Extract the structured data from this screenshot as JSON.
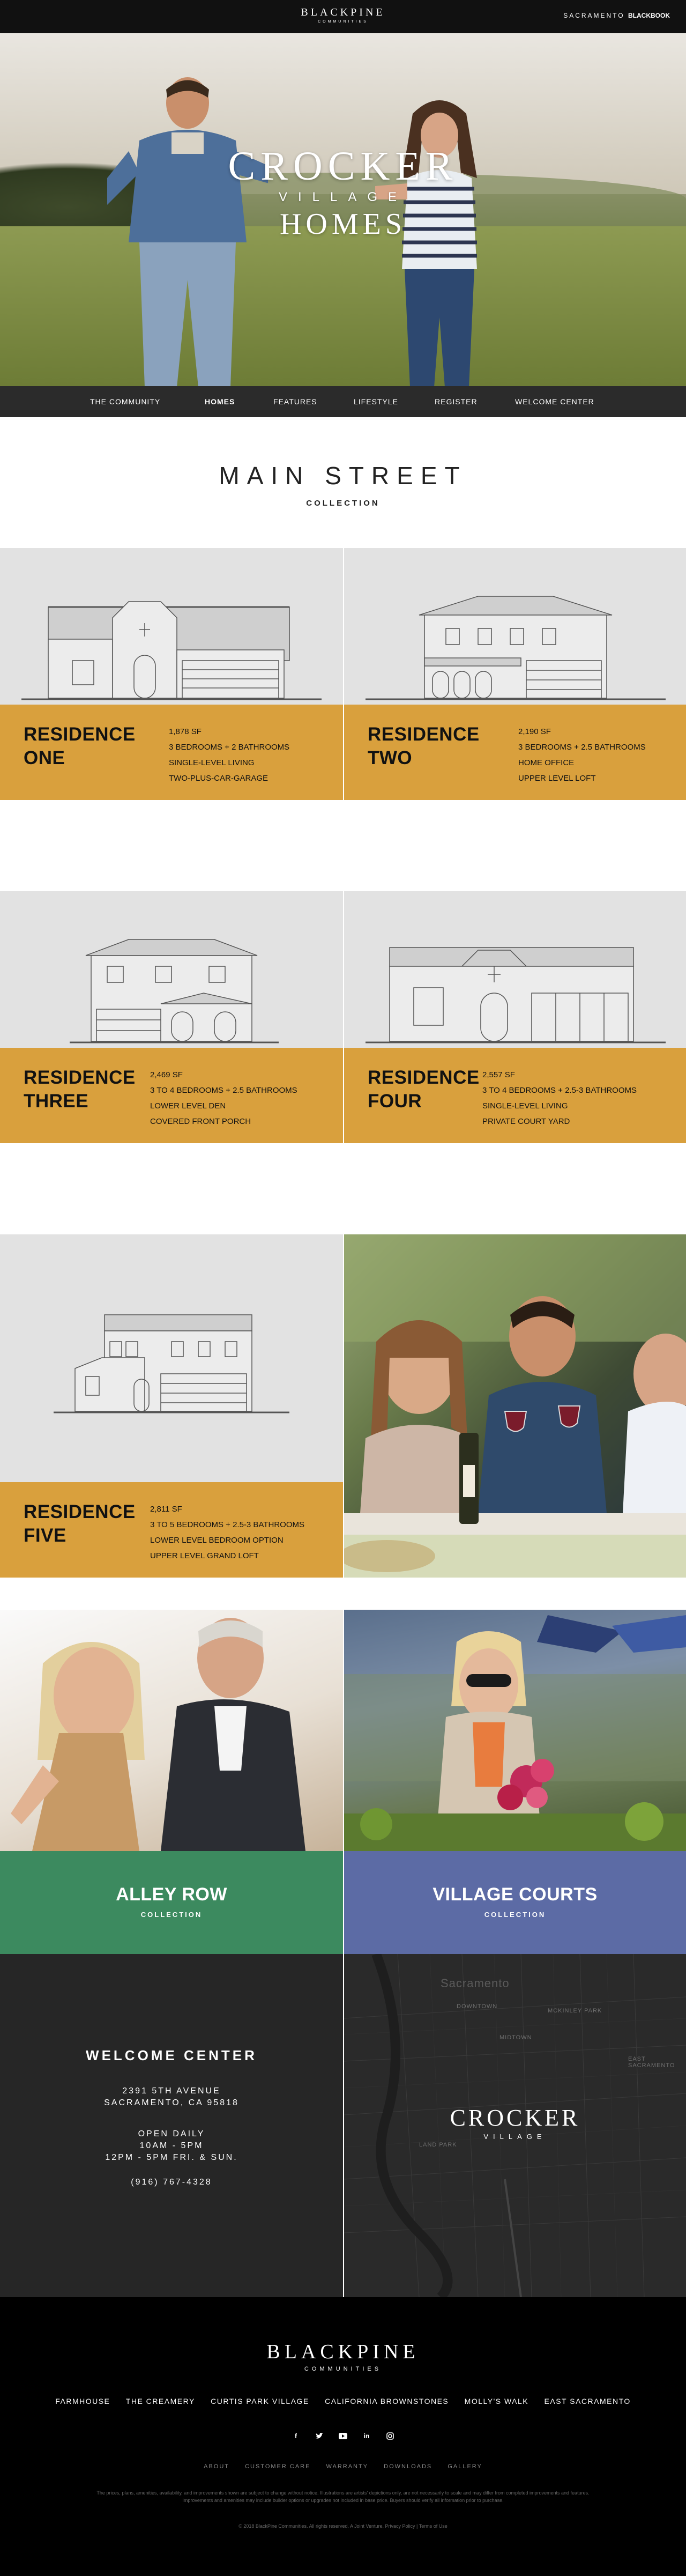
{
  "header": {
    "brand_name": "BLACKPINE",
    "brand_sub": "COMMUNITIES",
    "region": "SACRAMENTO",
    "partner": "BLACKBOOK"
  },
  "hero": {
    "title_1": "CROCKER",
    "title_2": "VILLAGE",
    "title_3": "HOMES"
  },
  "nav": {
    "items": [
      {
        "label": "THE COMMUNITY"
      },
      {
        "label": "HOMES"
      },
      {
        "label": "FEATURES"
      },
      {
        "label": "LIFESTYLE"
      },
      {
        "label": "REGISTER"
      },
      {
        "label": "WELCOME CENTER"
      }
    ],
    "active": "HOMES"
  },
  "section": {
    "title": "MAIN STREET",
    "subtitle": "COLLECTION"
  },
  "residences": [
    {
      "name_1": "RESIDENCE",
      "name_2": "ONE",
      "specs": [
        "1,878 SF",
        "3 BEDROOMS + 2 BATHROOMS",
        "SINGLE-LEVEL LIVING",
        "TWO-PLUS-CAR-GARAGE"
      ]
    },
    {
      "name_1": "RESIDENCE",
      "name_2": "TWO",
      "specs": [
        "2,190 SF",
        "3 BEDROOMS + 2.5 BATHROOMS",
        "HOME OFFICE",
        "UPPER LEVEL LOFT"
      ]
    },
    {
      "name_1": "RESIDENCE",
      "name_2": "THREE",
      "specs": [
        "2,469 SF",
        "3 TO 4 BEDROOMS + 2.5 BATHROOMS",
        "LOWER LEVEL DEN",
        "COVERED FRONT PORCH"
      ]
    },
    {
      "name_1": "RESIDENCE",
      "name_2": "FOUR",
      "specs": [
        "2,557 SF",
        "3 TO 4 BEDROOMS + 2.5-3 BATHROOMS",
        "SINGLE-LEVEL LIVING",
        "PRIVATE COURT YARD"
      ]
    },
    {
      "name_1": "RESIDENCE",
      "name_2": "FIVE",
      "specs": [
        "2,811 SF",
        "3 TO 5 BEDROOMS + 2.5-3 BATHROOMS",
        "LOWER LEVEL BEDROOM OPTION",
        "UPPER LEVEL GRAND LOFT"
      ]
    }
  ],
  "collections": [
    {
      "name": "ALLEY ROW",
      "sub": "COLLECTION",
      "color": "#3c8a5f"
    },
    {
      "name": "VILLAGE COURTS",
      "sub": "COLLECTION",
      "color": "#5c6ba5"
    }
  ],
  "welcome": {
    "title": "WELCOME CENTER",
    "address_1": "2391 5TH AVENUE",
    "address_2": "SACRAMENTO, CA 95818",
    "hours_1": "OPEN DAILY",
    "hours_2": "10AM - 5PM",
    "hours_3": "12PM - 5PM FRI. & SUN.",
    "phone": "(916) 767-4328"
  },
  "map": {
    "city": "Sacramento",
    "labels": [
      "DOWNTOWN",
      "MIDTOWN",
      "MCKINLEY PARK",
      "EAST SACRAMENTO",
      "LAND PARK"
    ],
    "logo_1": "CROCKER",
    "logo_2": "VILLAGE"
  },
  "footer": {
    "brand_name": "BLACKPINE",
    "brand_sub": "COMMUNITIES",
    "communities": [
      "FARMHOUSE",
      "THE CREAMERY",
      "CURTIS PARK VILLAGE",
      "CALIFORNIA BROWNSTONES",
      "MOLLY'S WALK",
      "EAST SACRAMENTO"
    ],
    "social_icons": [
      "facebook-icon",
      "twitter-icon",
      "youtube-icon",
      "linkedin-icon",
      "instagram-icon"
    ],
    "links": [
      "ABOUT",
      "CUSTOMER CARE",
      "WARRANTY",
      "DOWNLOADS",
      "GALLERY"
    ],
    "legal": "The prices, plans, amenities, availability, and improvements shown are subject to change without notice. Illustrations are artists' depictions only, are not necessarily to scale and may differ from completed improvements and features. Improvements and amenities may include builder options or upgrades not included in base price. Buyers should verify all information prior to purchase.",
    "copyright": "© 2018 BlackPine Communities. All rights reserved. A Joint Venture. Privacy Policy | Terms of Use"
  },
  "colors": {
    "accent_gold": "#d9a03d",
    "tile_gray": "#e2e2e2",
    "alley_green": "#3c8a5f",
    "village_blue": "#5c6ba5",
    "dark": "#262626"
  }
}
